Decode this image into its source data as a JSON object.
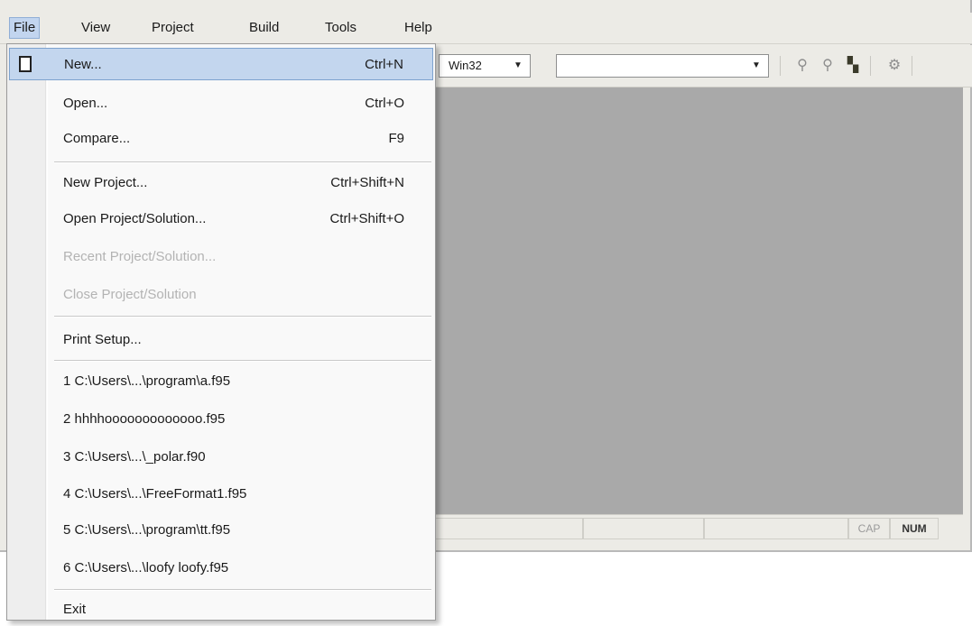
{
  "menubar": {
    "items": [
      {
        "label": "File"
      },
      {
        "label": "View"
      },
      {
        "label": "Project"
      },
      {
        "label": "Build"
      },
      {
        "label": "Tools"
      },
      {
        "label": "Help"
      }
    ]
  },
  "toolbar": {
    "platform_combo": {
      "value": "Win32",
      "icon": "chevron-down-icon"
    },
    "config_combo": {
      "value": "",
      "icon": "chevron-down-icon"
    },
    "icons": [
      "binoculars-icon",
      "binoculars-next-icon",
      "find-in-files-icon",
      "settings-icon"
    ]
  },
  "file_menu": {
    "items": [
      {
        "label": "New...",
        "shortcut": "Ctrl+N",
        "icon": "new-document-icon"
      },
      {
        "label": "Open...",
        "shortcut": "Ctrl+O"
      },
      {
        "label": "Compare...",
        "shortcut": "F9"
      },
      {
        "label": "New Project...",
        "shortcut": "Ctrl+Shift+N"
      },
      {
        "label": "Open Project/Solution...",
        "shortcut": "Ctrl+Shift+O"
      },
      {
        "label": "Recent Project/Solution...",
        "shortcut": ""
      },
      {
        "label": "Close Project/Solution",
        "shortcut": ""
      },
      {
        "label": "Print Setup...",
        "shortcut": ""
      },
      {
        "label": "1 C:\\Users\\...\\program\\a.f95",
        "shortcut": ""
      },
      {
        "label": "2 hhhhooooooooooooo.f95",
        "shortcut": ""
      },
      {
        "label": "3 C:\\Users\\...\\_polar.f90",
        "shortcut": ""
      },
      {
        "label": "4 C:\\Users\\...\\FreeFormat1.f95",
        "shortcut": ""
      },
      {
        "label": "5 C:\\Users\\...\\program\\tt.f95",
        "shortcut": ""
      },
      {
        "label": "6 C:\\Users\\...\\loofy loofy.f95",
        "shortcut": ""
      },
      {
        "label": "Exit",
        "shortcut": ""
      }
    ]
  },
  "statusbar": {
    "cap": "CAP",
    "num": "NUM"
  },
  "colors": {
    "highlight": "#c3d6ee",
    "workspace": "#a9a9a9",
    "chrome": "#ecebe6"
  }
}
